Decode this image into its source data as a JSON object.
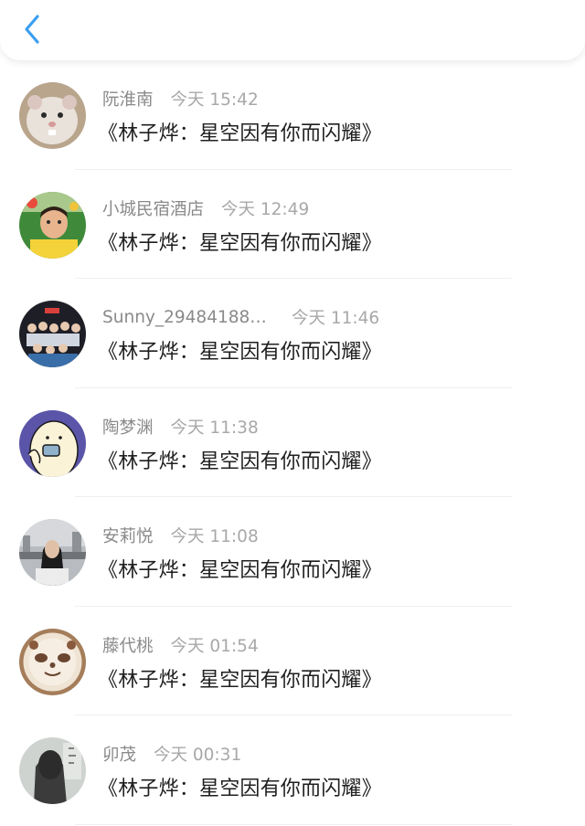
{
  "colors": {
    "accent": "#3b9ff0",
    "name_text": "#8a8a8a",
    "time_text": "#a8a8a8",
    "message_text": "#1f1f1f"
  },
  "header": {
    "back_icon": "chevron-left-icon"
  },
  "comments": [
    {
      "name": "阮淮南",
      "time": "今天 15:42",
      "text": "《林子烨：星空因有你而闪耀》",
      "avatar": "hamster-photo"
    },
    {
      "name": "小城民宿酒店",
      "time": "今天 12:49",
      "text": "《林子烨：星空因有你而闪耀》",
      "avatar": "child-photo"
    },
    {
      "name": "Sunny_294841881...",
      "time": "今天 11:46",
      "text": "《林子烨：星空因有你而闪耀》",
      "avatar": "group-photo"
    },
    {
      "name": "陶梦渊",
      "time": "今天 11:38",
      "text": "《林子烨：星空因有你而闪耀》",
      "avatar": "cartoon-phone"
    },
    {
      "name": "安莉悦",
      "time": "今天 11:08",
      "text": "《林子烨：星空因有你而闪耀》",
      "avatar": "girl-city-photo"
    },
    {
      "name": "藤代桃",
      "time": "今天 01:54",
      "text": "《林子烨：星空因有你而闪耀》",
      "avatar": "latte-art-photo"
    },
    {
      "name": "卯茂",
      "time": "今天 00:31",
      "text": "《林子烨：星空因有你而闪耀》",
      "avatar": "girl-back-photo"
    }
  ]
}
